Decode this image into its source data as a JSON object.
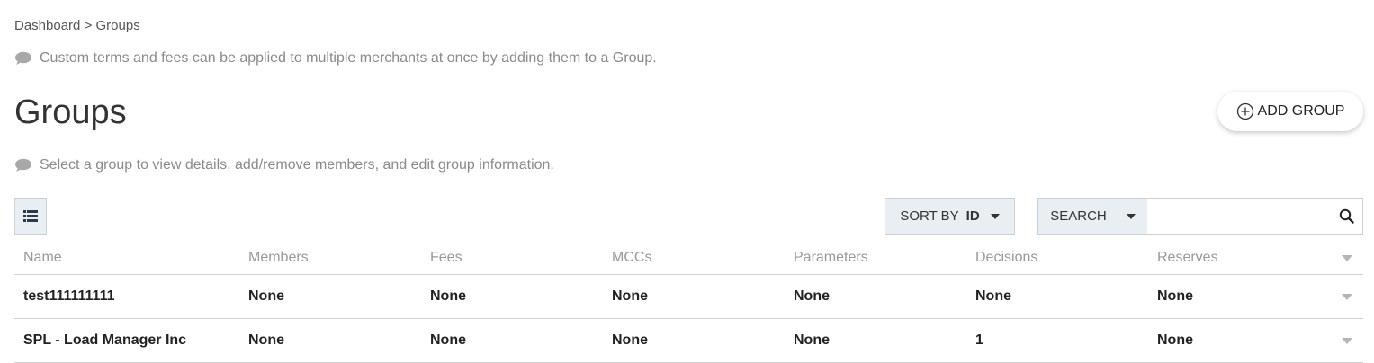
{
  "breadcrumb": {
    "home": "Dashboard ",
    "separator": ">",
    "current": "Groups"
  },
  "hints": {
    "top": "Custom terms and fees can be applied to multiple merchants at once by adding them to a Group.",
    "list": "Select a group to view details, add/remove members, and edit group information."
  },
  "page": {
    "title": "Groups"
  },
  "actions": {
    "add_group": "ADD GROUP"
  },
  "toolbar": {
    "sort_label": "SORT BY",
    "sort_value": "ID",
    "search_label": "SEARCH",
    "search_value": ""
  },
  "table": {
    "columns": [
      "Name",
      "Members",
      "Fees",
      "MCCs",
      "Parameters",
      "Decisions",
      "Reserves"
    ],
    "rows": [
      [
        "test111111111",
        "None",
        "None",
        "None",
        "None",
        "None",
        "None"
      ],
      [
        "SPL - Load Manager Inc",
        "None",
        "None",
        "None",
        "None",
        "1",
        "None"
      ]
    ]
  },
  "icons": {
    "hint": "speech-bubble-icon",
    "add": "plus-circle-icon",
    "view": "list-view-icon",
    "search": "search-icon",
    "dropdown": "chevron-down-icon"
  },
  "colors": {
    "text": "#333333",
    "muted": "#8a8a8a",
    "toolbar_bg": "#e9eef2",
    "border": "#c9d1d8"
  }
}
